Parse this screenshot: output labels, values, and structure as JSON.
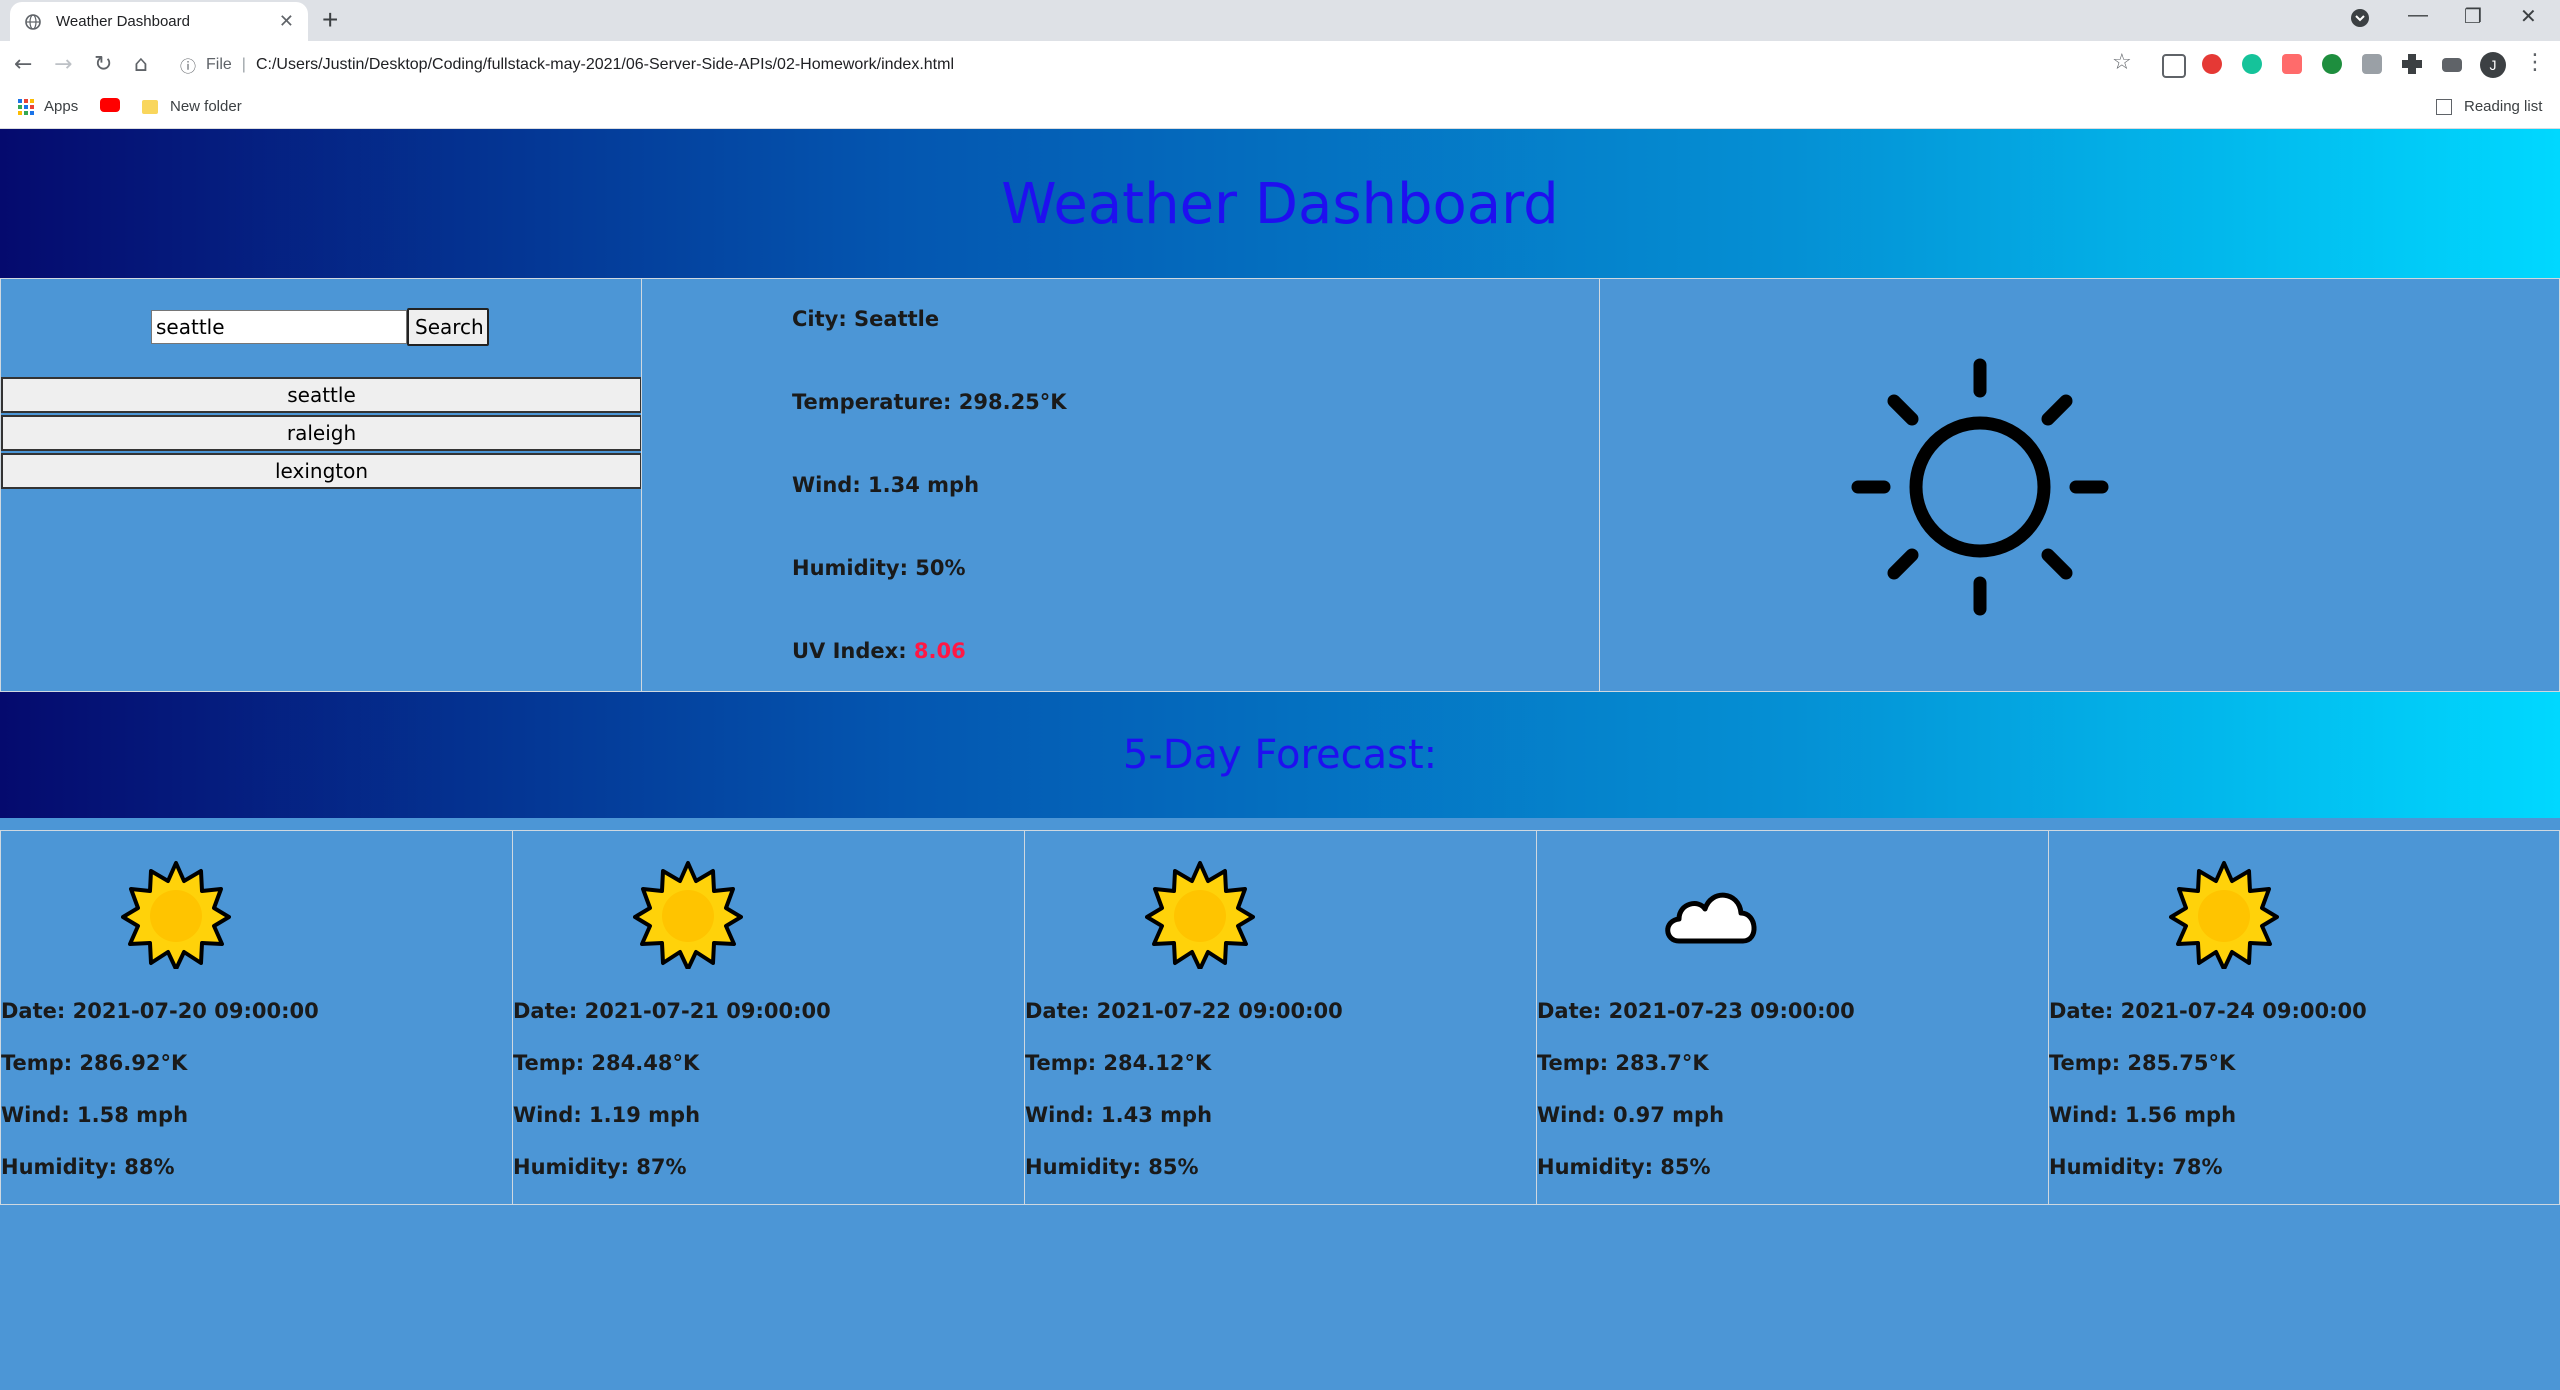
{
  "browser": {
    "tab_title": "Weather Dashboard",
    "url_scheme": "File",
    "url": "C:/Users/Justin/Desktop/Coding/fullstack-may-2021/06-Server-Side-APIs/02-Homework/index.html",
    "bookmarks": [
      {
        "label": "Apps",
        "icon": "apps-grid-icon"
      },
      {
        "label": "",
        "icon": "youtube-icon"
      },
      {
        "label": "New folder",
        "icon": "folder-icon"
      }
    ],
    "reading_list": "Reading list",
    "profile_initial": "J"
  },
  "header": {
    "title": "Weather Dashboard"
  },
  "search": {
    "input_value": "seattle",
    "button_label": "Search",
    "history": [
      "seattle",
      "raleigh",
      "lexington"
    ]
  },
  "current": {
    "city": "City: Seattle",
    "temperature": "Temperature: 298.25°K",
    "wind": "Wind: 1.34 mph",
    "humidity": "Humidity: 50%",
    "uv_label": "UV Index: ",
    "uv_value": "8.06",
    "uv_color": "#ff1744",
    "icon": "sun-outline-icon"
  },
  "forecast": {
    "title": "5-Day Forecast:",
    "days": [
      {
        "icon": "sun-icon",
        "date": "Date: 2021-07-20 09:00:00",
        "temp": "Temp: 286.92°K",
        "wind": "Wind: 1.58 mph",
        "humidity": "Humidity: 88%"
      },
      {
        "icon": "sun-icon",
        "date": "Date: 2021-07-21 09:00:00",
        "temp": "Temp: 284.48°K",
        "wind": "Wind: 1.19 mph",
        "humidity": "Humidity: 87%"
      },
      {
        "icon": "sun-icon",
        "date": "Date: 2021-07-22 09:00:00",
        "temp": "Temp: 284.12°K",
        "wind": "Wind: 1.43 mph",
        "humidity": "Humidity: 85%"
      },
      {
        "icon": "cloud-icon",
        "date": "Date: 2021-07-23 09:00:00",
        "temp": "Temp: 283.7°K",
        "wind": "Wind: 0.97 mph",
        "humidity": "Humidity: 85%"
      },
      {
        "icon": "sun-icon",
        "date": "Date: 2021-07-24 09:00:00",
        "temp": "Temp: 285.75°K",
        "wind": "Wind: 1.56 mph",
        "humidity": "Humidity: 78%"
      }
    ]
  },
  "colors": {
    "page_bg": "#4c96d6",
    "title_color": "#1f0ff0",
    "gradient_start": "#050a6e",
    "gradient_end": "#00d8ff"
  }
}
